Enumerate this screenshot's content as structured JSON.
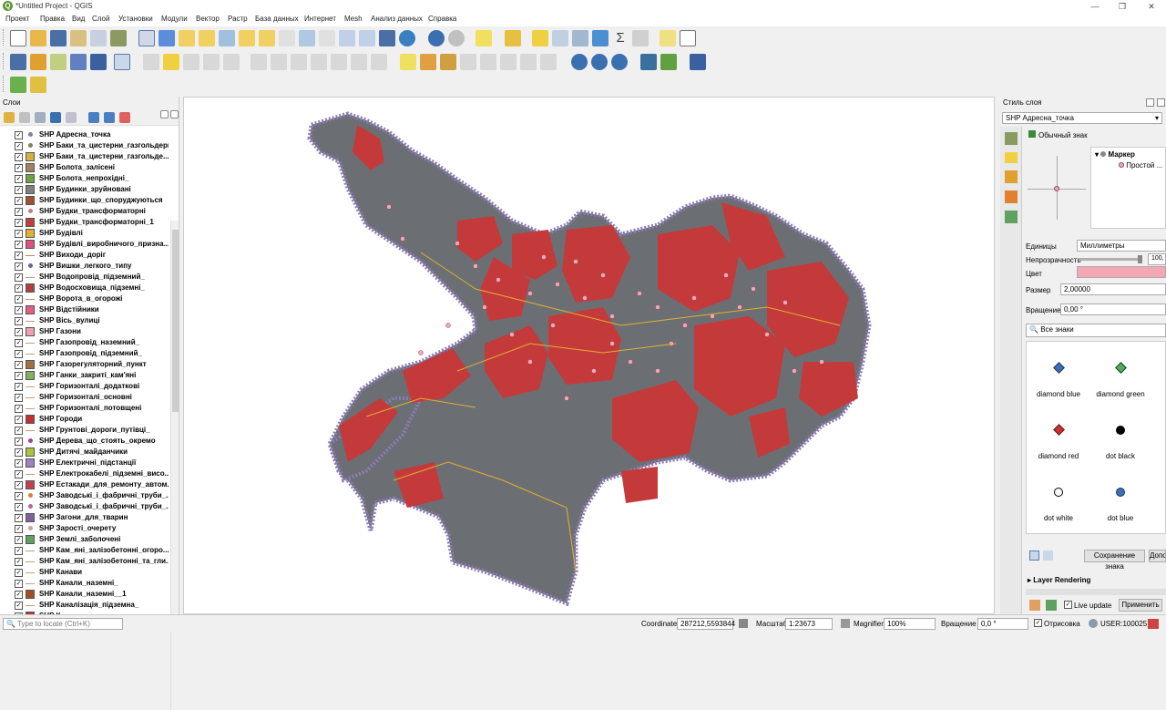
{
  "window": {
    "title": "*Untitled Project - QGIS"
  },
  "menu": [
    "Проект",
    "Правка",
    "Вид",
    "Слой",
    "Установки",
    "Модули",
    "Вектор",
    "Растр",
    "База данных",
    "Интернет",
    "Mesh",
    "Анализ данных",
    "Справка"
  ],
  "layers_panel": {
    "title": "Слои",
    "items": [
      {
        "label": "SHP Адресна_точка",
        "color": "#8080a0",
        "shape": "dot"
      },
      {
        "label": "SHP Баки_та_цистерни_газгольдери",
        "color": "#808060",
        "shape": "dot"
      },
      {
        "label": "SHP Баки_та_цистерни_газгольде...",
        "color": "#d4b040",
        "shape": "fill"
      },
      {
        "label": "SHP Болота_залісені",
        "color": "#a08060",
        "shape": "fill"
      },
      {
        "label": "SHP Болота_непрохідні_",
        "color": "#70a040",
        "shape": "fill"
      },
      {
        "label": "SHP Будинки_зруйновані",
        "color": "#808080",
        "shape": "fill"
      },
      {
        "label": "SHP Будинки_що_споруджуються",
        "color": "#a05030",
        "shape": "fill"
      },
      {
        "label": "SHP Будки_трансформаторні",
        "color": "#c08080",
        "shape": "dot"
      },
      {
        "label": "SHP Будки_трансформаторні_1",
        "color": "#c04040",
        "shape": "fill"
      },
      {
        "label": "SHP Будівлі",
        "color": "#e0b030",
        "shape": "fill"
      },
      {
        "label": "SHP Будівлі_виробничого_призна...",
        "color": "#e05080",
        "shape": "fill"
      },
      {
        "label": "SHP Виходи_доріг",
        "color": "#b09060",
        "shape": "line"
      },
      {
        "label": "SHP Вишки_легкого_типу",
        "color": "#7060a0",
        "shape": "dot"
      },
      {
        "label": "SHP Водопровід_підземний_",
        "color": "#c0a080",
        "shape": "line"
      },
      {
        "label": "SHP Водосховища_підземні_",
        "color": "#b04040",
        "shape": "fill"
      },
      {
        "label": "SHP Ворота_в_огорожі",
        "color": "#c09070",
        "shape": "line"
      },
      {
        "label": "SHP Відстійники",
        "color": "#e06080",
        "shape": "fill"
      },
      {
        "label": "SHP Вісь_вулиці",
        "color": "#b0a080",
        "shape": "line"
      },
      {
        "label": "SHP Газони",
        "color": "#f0a0b0",
        "shape": "fill"
      },
      {
        "label": "SHP Газопровід_наземний_",
        "color": "#c0a080",
        "shape": "line"
      },
      {
        "label": "SHP Газопровід_підземний_",
        "color": "#c0a080",
        "shape": "line"
      },
      {
        "label": "SHP Газорегуляторний_пункт",
        "color": "#a07040",
        "shape": "fill"
      },
      {
        "label": "SHP Ганки_закриті_кам'яні",
        "color": "#80b060",
        "shape": "fill"
      },
      {
        "label": "SHP Горизонталі_додаткові",
        "color": "#c0a080",
        "shape": "line"
      },
      {
        "label": "SHP Горизонталі_основні",
        "color": "#c0a080",
        "shape": "line"
      },
      {
        "label": "SHP Горизонталі_потовщені",
        "color": "#c0a080",
        "shape": "line"
      },
      {
        "label": "SHP Городи",
        "color": "#c03030",
        "shape": "fill"
      },
      {
        "label": "SHP Грунтові_дороги_путівці_",
        "color": "#c0a080",
        "shape": "line"
      },
      {
        "label": "SHP Дерева_що_стоять_окремо",
        "color": "#a040a0",
        "shape": "dot"
      },
      {
        "label": "SHP Дитячі_майданчики",
        "color": "#b0c040",
        "shape": "fill"
      },
      {
        "label": "SHP Електричні_підстанції",
        "color": "#a080c0",
        "shape": "fill"
      },
      {
        "label": "SHP Електрокабелі_підземні_висо...",
        "color": "#c0a080",
        "shape": "line"
      },
      {
        "label": "SHP Естакади_для_ремонту_автом...",
        "color": "#c04050",
        "shape": "fill"
      },
      {
        "label": "SHP Заводські_і_фабричні_труби_...",
        "color": "#d08040",
        "shape": "dot"
      },
      {
        "label": "SHP Заводські_і_фабричні_труби_...",
        "color": "#c060a0",
        "shape": "dot"
      },
      {
        "label": "SHP Загони_для_тварин",
        "color": "#8060a0",
        "shape": "fill"
      },
      {
        "label": "SHP Зарості_очерету",
        "color": "#d0a0a0",
        "shape": "dot"
      },
      {
        "label": "SHP Землі_заболочені",
        "color": "#60a060",
        "shape": "fill"
      },
      {
        "label": "SHP Кам_яні_залізобетонні_огоро...",
        "color": "#c0a080",
        "shape": "line"
      },
      {
        "label": "SHP Кам_яні_залізобетонні_та_гли...",
        "color": "#c0a080",
        "shape": "line"
      },
      {
        "label": "SHP Канави",
        "color": "#c0a080",
        "shape": "line"
      },
      {
        "label": "SHP Канали_наземні_",
        "color": "#c0a080",
        "shape": "line"
      },
      {
        "label": "SHP Канали_наземні__1",
        "color": "#a05020",
        "shape": "fill"
      },
      {
        "label": "SHP Каналізація_підземна_",
        "color": "#c0a080",
        "shape": "line"
      },
      {
        "label": "SHP К...",
        "color": "#c03030",
        "shape": "fill"
      }
    ]
  },
  "style_panel": {
    "title": "Стиль слоя",
    "layer": "SHP Адресна_точка",
    "renderer": "Обычный знак",
    "tree": {
      "root": "Маркер",
      "child": "Простой ..."
    },
    "units_label": "Единицы",
    "units_value": "Миллиметры",
    "opacity_label": "Непрозрачность",
    "opacity_value": "100,",
    "color_label": "Цвет",
    "color_value": "#f4a6b4",
    "size_label": "Размер",
    "size_value": "2,00000",
    "rotation_label": "Вращение",
    "rotation_value": "0,00 °",
    "search_placeholder": "Все знаки",
    "symbols": [
      {
        "name": "diamond blue",
        "color": "#3a6fc0",
        "shape": "diamond"
      },
      {
        "name": "diamond green",
        "color": "#4caf50",
        "shape": "diamond"
      },
      {
        "name": "diamond red",
        "color": "#d32f2f",
        "shape": "diamond"
      },
      {
        "name": "dot  black",
        "color": "#000000",
        "shape": "dot"
      },
      {
        "name": "dot  white",
        "color": "#ffffff",
        "shape": "dot"
      },
      {
        "name": "dot blue",
        "color": "#3a6fc0",
        "shape": "dot"
      }
    ],
    "save_symbol": "Сохранение знака",
    "save_more": "Допо",
    "layer_rendering": "Layer Rendering",
    "live_update": "Live update",
    "apply": "Применить"
  },
  "status": {
    "locate_placeholder": "Type to locate (Ctrl+K)",
    "coordinate_label": "Coordinate",
    "coordinate_value": "287212,5593844",
    "scale_label": "Масштаб",
    "scale_value": "1:23673",
    "magnifier_label": "Magnifier",
    "magnifier_value": "100%",
    "rotation_label": "Вращение",
    "rotation_value": "0,0 °",
    "render_label": "Отрисовка",
    "crs": "USER:100025"
  }
}
